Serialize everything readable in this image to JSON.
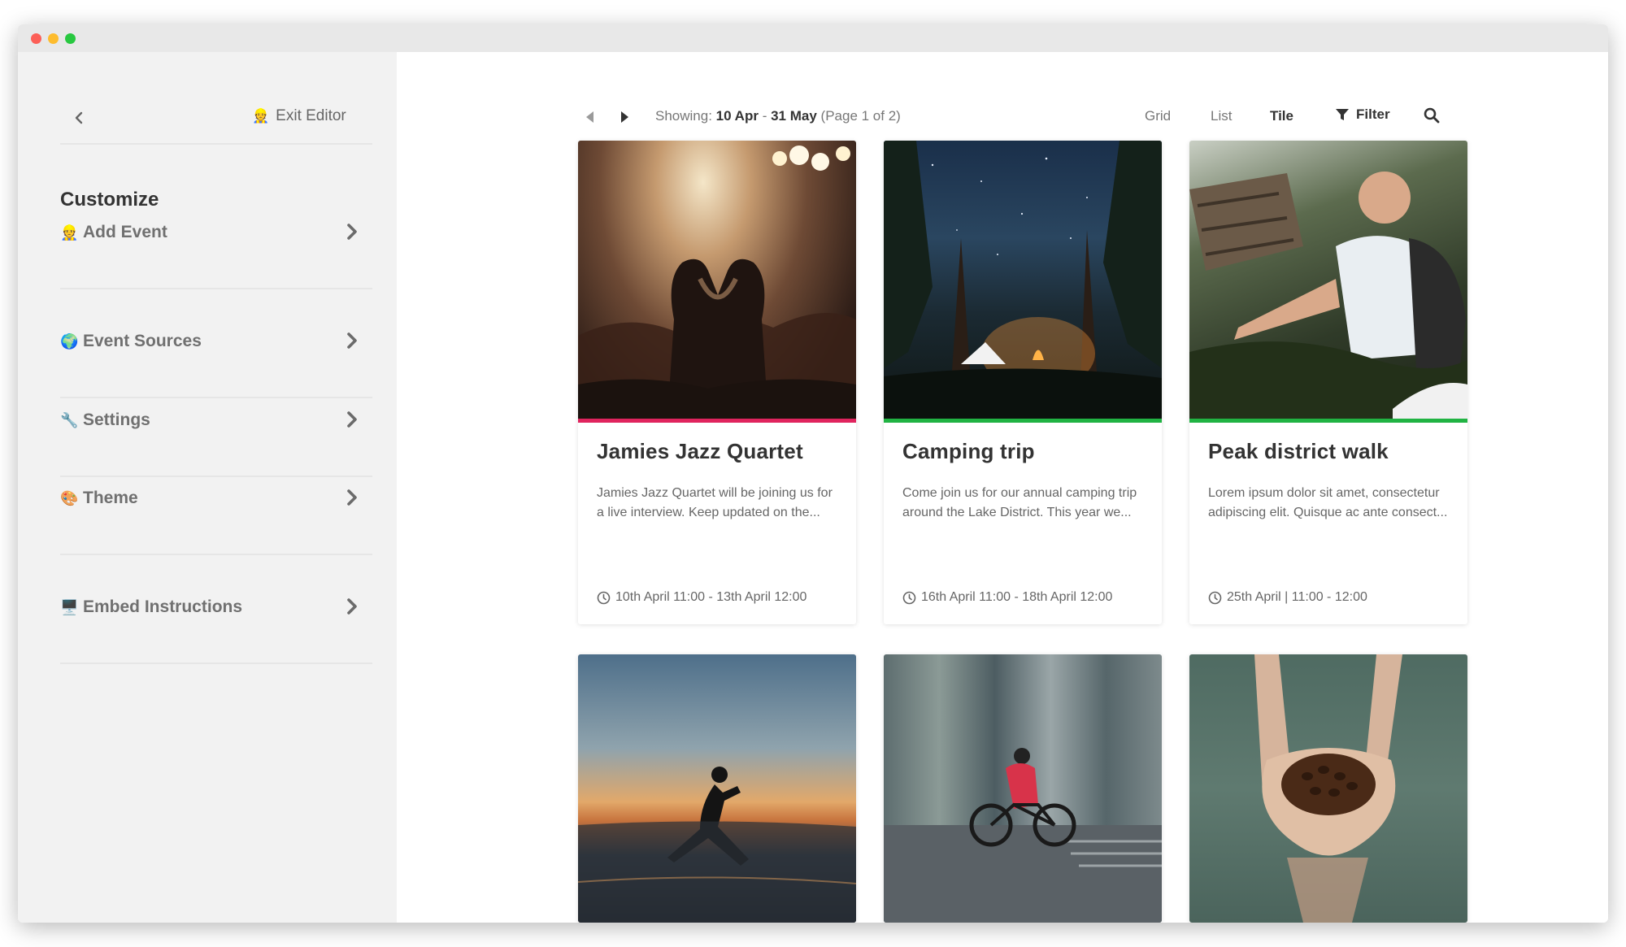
{
  "sidebar": {
    "back_icon": "chevron-left-icon",
    "exit_editor": {
      "emoji": "👷",
      "label": "Exit Editor"
    },
    "heading": "Customize",
    "items": [
      {
        "emoji": "👷",
        "label": "Add Event"
      },
      {
        "emoji": "🌍",
        "label": "Event Sources"
      },
      {
        "emoji": "🔧",
        "label": "Settings"
      },
      {
        "emoji": "🎨",
        "label": "Theme"
      },
      {
        "emoji": "🖥️",
        "label": "Embed Instructions"
      }
    ]
  },
  "toolbar": {
    "showing_prefix": "Showing:",
    "start": "10 Apr",
    "separator": "-",
    "end": "31 May",
    "page": "(Page 1 of 2)",
    "views": [
      "Grid",
      "List",
      "Tile"
    ],
    "active_view": "Tile",
    "filter_label": "Filter"
  },
  "events": [
    {
      "title": "Jamies Jazz Quartet",
      "description": "Jamies Jazz Quartet will be joining us for a live interview. Keep updated on the...",
      "time": "10th April 11:00 - 13th April 12:00",
      "color": "#e0245e",
      "image": "concert crowd"
    },
    {
      "title": "Camping trip",
      "description": "Come join us for our annual camping trip around the Lake District. This year we...",
      "time": "16th April 11:00 - 18th April 12:00",
      "color": "#21b343",
      "image": "campsite under stars"
    },
    {
      "title": "Peak district walk",
      "description": "Lorem ipsum dolor sit amet, consectetur adipiscing elit. Quisque ac ante consect...",
      "time": "25th April | 11:00 - 12:00",
      "color": "#21b343",
      "image": "hiker with backpack"
    },
    {
      "image": "runner at sunset"
    },
    {
      "image": "cyclist in city"
    },
    {
      "image": "hands holding coffee beans"
    }
  ],
  "colors": {
    "sidebar_bg": "#f2f2f2",
    "pink_accent": "#e0245e",
    "green_accent": "#21b343"
  }
}
